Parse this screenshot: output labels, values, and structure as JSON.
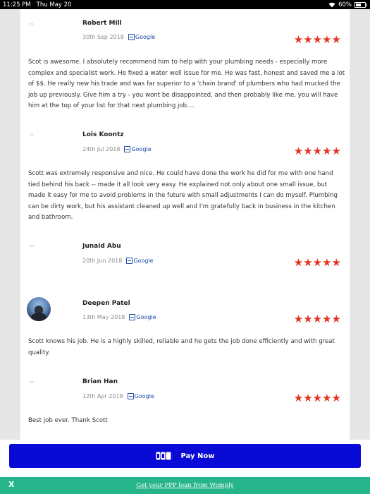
{
  "status_bar": {
    "time": "11:25 PM",
    "date": "Thu May 20",
    "battery": "60%",
    "battery_level": 0.6
  },
  "reviews": [
    {
      "name": "Robert Mill",
      "date": "30th Sep 2018",
      "source": "Google",
      "rating": 5,
      "avatar": "broken-image",
      "text": "Scot is awesome. I absolutely recommend him to help with your plumbing needs - especially more complex and specialist work. He fixed a water well issue for me. He was fast, honest and saved me a lot of $$. He really new his trade and was far superior to a 'chain brand' of plumbers who had mucked the job up previously. Give him a try - you wont be disappointed, and then probably like me, you will have him at the top of your list for that next plumbing job...."
    },
    {
      "name": "Lois Koontz",
      "date": "24th Jul 2018",
      "source": "Google",
      "rating": 5,
      "avatar": "broken-image",
      "text": "Scott was extremely responsive and nice. He could have done the work he did for me with one hand tied behind his back -- made it all look very easy. He explained not only about one small issue, but made it easy for me to avoid problems in the future with small adjustments I can do myself. Plumbing can be dirty work, but his assistant cleaned up well and I'm gratefully back in business in the kitchen and bathroom."
    },
    {
      "name": "Junaid Abu",
      "date": "20th Jun 2018",
      "source": "Google",
      "rating": 5,
      "avatar": "broken-image",
      "text": ""
    },
    {
      "name": "Deepen Patel",
      "date": "13th May 2018",
      "source": "Google",
      "rating": 5,
      "avatar": "photo",
      "text": "Scott knows his job. He is a highly skilled, reliable and he gets the job done efficiently and with great quality."
    },
    {
      "name": "Brian Han",
      "date": "12th Apr 2018",
      "source": "Google",
      "rating": 5,
      "avatar": "broken-image",
      "text": "Best job ever. Thank Scott"
    }
  ],
  "star_glyph": "★★★★★",
  "star_color": "#e2341f",
  "pay_button": {
    "label": "Pay Now",
    "icon": "wallet-icon",
    "color": "#0a0ad6"
  },
  "promo": {
    "close_label": "X",
    "link_text": "Get your PPP loan from Womply",
    "color": "#26b58a"
  }
}
